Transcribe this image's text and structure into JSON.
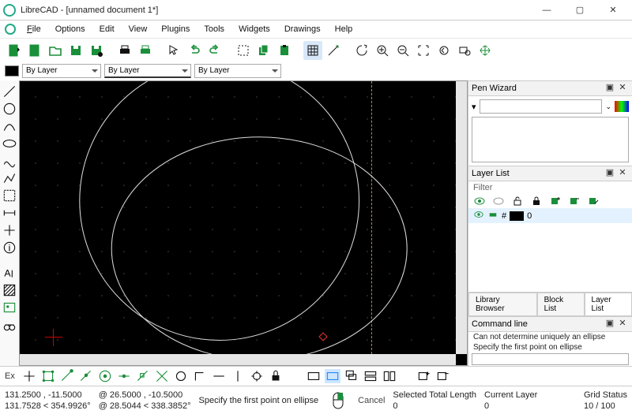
{
  "window": {
    "title": "LibreCAD - [unnamed document 1*]"
  },
  "menu": {
    "file": "File",
    "options": "Options",
    "edit": "Edit",
    "view": "View",
    "plugins": "Plugins",
    "tools": "Tools",
    "widgets": "Widgets",
    "drawings": "Drawings",
    "help": "Help"
  },
  "layerbar": {
    "by_layer": "By Layer"
  },
  "panes": {
    "pen_wizard": {
      "title": "Pen Wizard"
    },
    "layer_list": {
      "title": "Layer List",
      "filter": "Filter",
      "layer0": "0"
    },
    "tabs": {
      "library": "Library Browser",
      "block": "Block List",
      "layer": "Layer List"
    },
    "cmd": {
      "title": "Command line",
      "log1": "Can not determine uniquely an ellipse",
      "prompt": "Specify the first point on ellipse"
    }
  },
  "snapbar": {
    "ex": "Ex"
  },
  "status": {
    "coord_abs": "131.2500 , -11.5000",
    "coord_rel": "131.7528 < 354.9926°",
    "at1": "@  26.5000 , -10.5000",
    "at2": "@  28.5044 < 338.3852°",
    "prompt": "Specify the first point on ellipse",
    "cancel": "Cancel",
    "sel_len_label": "Selected Total Length",
    "sel_len": "0",
    "cur_layer_label": "Current Layer",
    "cur_layer": "0",
    "grid_label": "Grid Status",
    "grid": "10 / 100"
  }
}
